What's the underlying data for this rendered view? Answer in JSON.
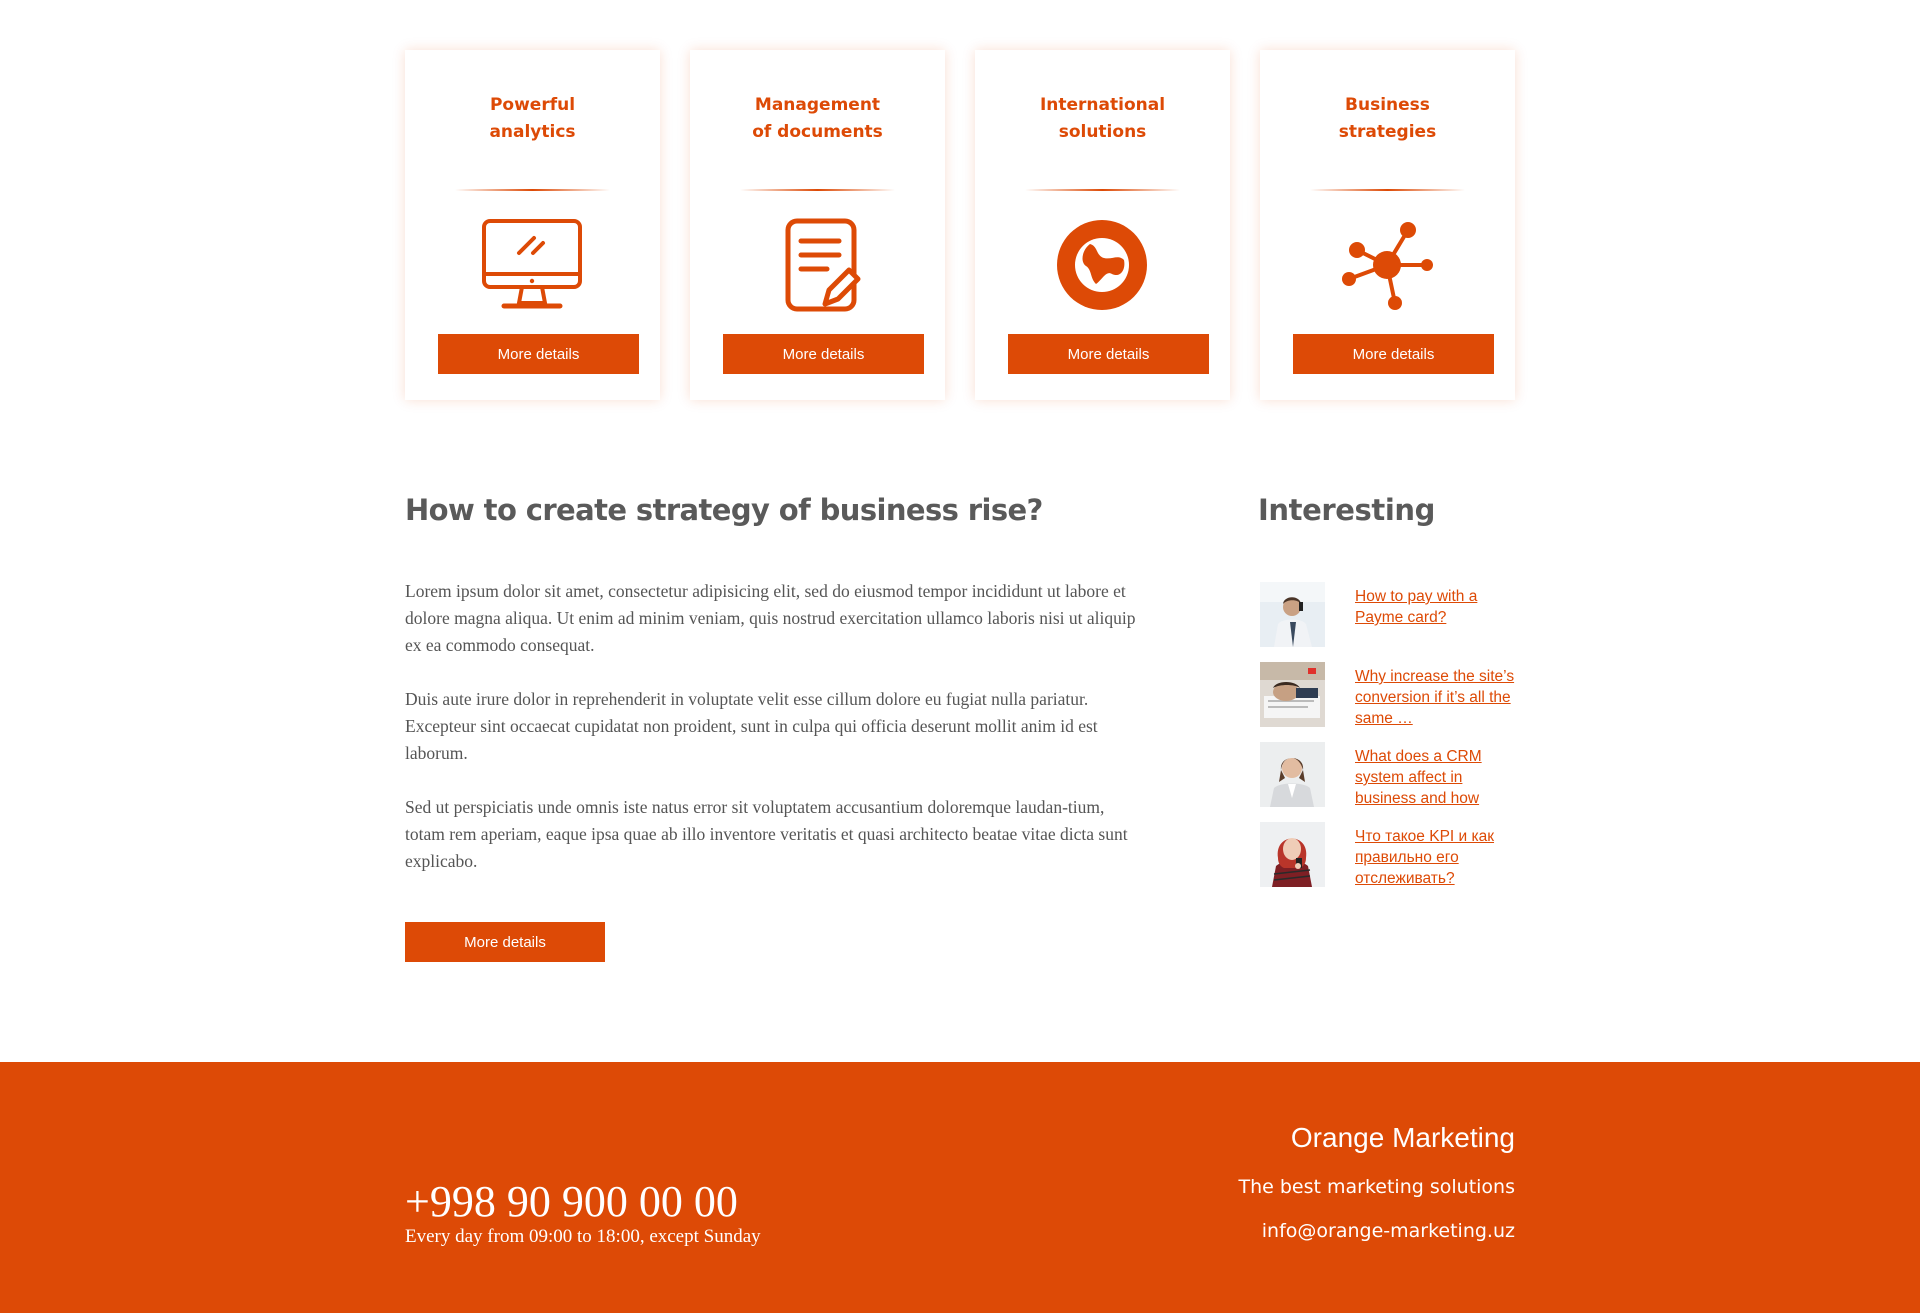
{
  "colors": {
    "accent": "#dd4a06",
    "heading": "#5a5a5a",
    "text": "#555555",
    "footer_bg": "#dd4a06"
  },
  "cards": [
    {
      "title": "Powerful\nanalytics",
      "icon": "monitor-icon",
      "button": "More details"
    },
    {
      "title": "Management\nof documents",
      "icon": "document-edit-icon",
      "button": "More details"
    },
    {
      "title": "International\nsolutions",
      "icon": "globe-icon",
      "button": "More details"
    },
    {
      "title": "Business\nstrategies",
      "icon": "network-icon",
      "button": "More details"
    }
  ],
  "article": {
    "title": "How to create strategy of business rise?",
    "paragraphs": [
      "Lorem ipsum dolor sit amet, consectetur adipisicing elit, sed do eiusmod tempor incididunt ut labore et dolore magna aliqua. Ut enim ad minim veniam, quis nostrud exercitation ullamco laboris nisi ut aliquip ex ea commodo consequat.",
      "Duis aute irure dolor in reprehenderit in voluptate velit esse cillum dolore eu fugiat nulla pariatur. Excepteur sint occaecat cupidatat non proident, sunt in culpa qui officia deserunt mollit anim id est laborum.",
      "Sed ut perspiciatis unde omnis iste natus error sit voluptatem accusantium doloremque laudan-tium, totam rem aperiam, eaque ipsa quae ab illo inventore veritatis et quasi architecto beatae vitae dicta sunt explicabo."
    ],
    "button": "More details"
  },
  "sidebar": {
    "title": "Interesting",
    "items": [
      {
        "label": "How to pay with a Payme card?",
        "thumb": "man-phone-photo"
      },
      {
        "label": "Why increase the site’s conversion if it’s all the same …",
        "thumb": "sleeping-worker-photo"
      },
      {
        "label": "What does a CRM system affect in business and how",
        "thumb": "business-woman-photo"
      },
      {
        "label": "Что такое KPI и как правильно его отслеживать?",
        "thumb": "woman-red-hair-photo"
      }
    ]
  },
  "footer": {
    "phone": "+998 90 900 00 00",
    "hours": "Every day from 09:00 to 18:00, except Sunday",
    "brand": "Orange Marketing",
    "tagline": "The best marketing solutions",
    "email": "info@orange-marketing.uz"
  }
}
